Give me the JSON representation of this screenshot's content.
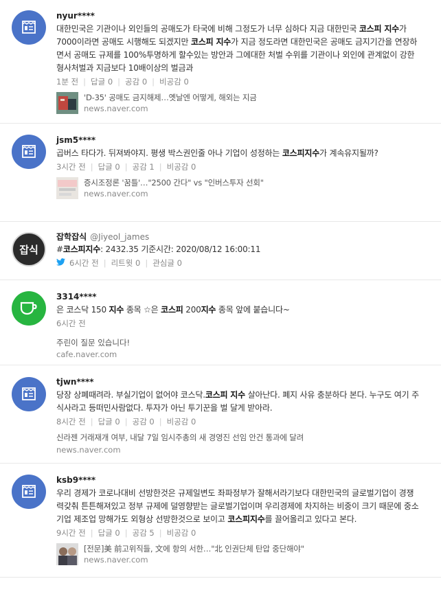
{
  "posts": [
    {
      "author": "nyur****",
      "text_parts": [
        "대한민국은 기관이나 외인들의 공매도가 타국에 비해 그정도가 너무 심하다 지금 대한민국 ",
        "코스피 지수",
        "가 7000이라면 공매도 시행해도 되겠지만 ",
        "코스피 지수",
        "가 지금 정도라면 대한민국은 공매도 금지기간을 연장하면서 공매도 규제를 100%투명하게 할수있는 방안과 그에대한 처벌 수위를 기관이나 외인에 관계없이 강한 형사처벌과 지금보다 10배이상의 벌금과"
      ],
      "time": "1분 전",
      "reply": "답글 0",
      "like": "공감 0",
      "dislike": "비공감 0",
      "link_title": "'D-35' 공매도 금지해제…옛날엔 어떻게, 해외는 지금",
      "link_domain": "news.naver.com"
    },
    {
      "author": "jsm5****",
      "text_parts": [
        "곱버스 타다가. 뒤져봐야지. 평생 박스권인줄 아나 기업이 성정하는 ",
        "코스피지수",
        "가 계속유지될까?"
      ],
      "time": "3시간 전",
      "reply": "답글 0",
      "like": "공감 1",
      "dislike": "비공감 0",
      "link_title": "증시조정론 '꿈틀'…\"2500 간다\" vs \"인버스투자 선회\"",
      "link_domain": "news.naver.com"
    },
    {
      "author": "잡학잡식",
      "handle": "@Jiyeol_james",
      "avatar_text": "잡식",
      "text_prefix": "#",
      "text_bold": "코스피지수",
      "text_rest": ": 2432.35 기준시간: 2020/08/12 16:00:11",
      "time": "6시간 전",
      "retweet": "리트윗 0",
      "fav": "관심글 0"
    },
    {
      "author": "3314****",
      "text_parts": [
        "은 코스닥 150 ",
        "지수",
        " 종목 ☆은 ",
        "코스피",
        " 200",
        "지수",
        " 종목 앞에 붙습니다~"
      ],
      "time": "6시간 전",
      "cafe_title": "주린이 질문 있습니다!",
      "cafe_domain": "cafe.naver.com"
    },
    {
      "author": "tjwn****",
      "text_parts": [
        "당장 상폐때려라. 부실기업이 없어야 코스닥.",
        "코스피 지수",
        " 살아난다. 폐지 사유 충분하다 본다. 누구도 여기 주식사라고 등떠민사람없다. 투자가 아닌 투기꾼을 벌 달게 받아라."
      ],
      "time": "8시간 전",
      "reply": "답글 0",
      "like": "공감 0",
      "dislike": "비공감 0",
      "link_title": "신라젠 거래재개 여부, 내달 7일 임시주총의 새 경영진 선임 안건 통과에 달려",
      "link_domain": "news.naver.com"
    },
    {
      "author": "ksb9****",
      "text_parts": [
        "우리 경제가 코로나대비 선방한것은 규제일변도 좌파정부가 잘해서라기보다 대한민국의 글로벌기업이 경쟁력갖춰 튼튼해져있고 정부 규제에 덜영향받는 글로벌기업이며 우리경제에 차지하는 비중이 크기 때문에 중소기업 제조업 망해가도 외형상 선방한것으로 보이고 ",
        "코스피지수",
        "를 끌어올리고 있다고 본다."
      ],
      "time": "9시간 전",
      "reply": "답글 0",
      "like": "공감 5",
      "dislike": "비공감 0",
      "link_title": "[전문]美 前고위직들, 文에 항의 서한…\"北 인권단체 탄압 중단해야\"",
      "link_domain": "news.naver.com"
    }
  ],
  "colors": {
    "naver_avatar": "#4a73c8",
    "cafe_avatar": "#27b540",
    "twitter_bird": "#1da1f2"
  },
  "icons": {
    "naver_avatar": "naver-news-icon",
    "cafe_avatar": "cafe-cup-icon",
    "twitter": "twitter-bird-icon"
  }
}
